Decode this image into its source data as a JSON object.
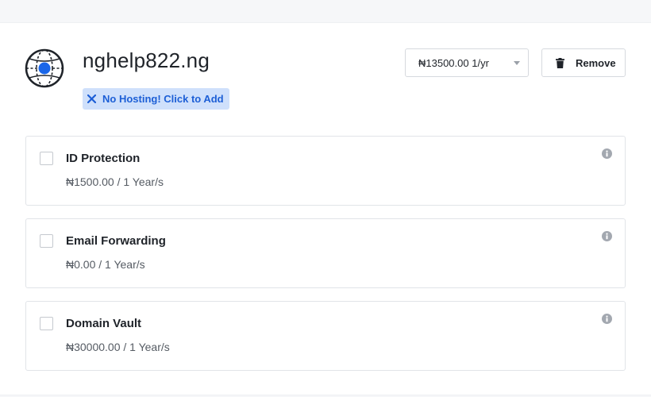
{
  "domain": {
    "name": "nghelp822.ng",
    "hosting_badge": "No Hosting! Click to Add"
  },
  "price_select": {
    "selected": "₦13500.00 1/yr"
  },
  "remove_button": {
    "label": "Remove"
  },
  "addons": [
    {
      "title": "ID Protection",
      "price": "₦1500.00 / 1 Year/s",
      "checked": false
    },
    {
      "title": "Email Forwarding",
      "price": "₦0.00 / 1 Year/s",
      "checked": false
    },
    {
      "title": "Domain Vault",
      "price": "₦30000.00 / 1 Year/s",
      "checked": false
    }
  ],
  "colors": {
    "accent": "#1d5fd6",
    "badge_bg": "#cfe0fb",
    "globe_dot": "#1a66e8"
  },
  "icons": [
    "globe-icon",
    "close-icon",
    "trash-icon",
    "info-icon"
  ]
}
